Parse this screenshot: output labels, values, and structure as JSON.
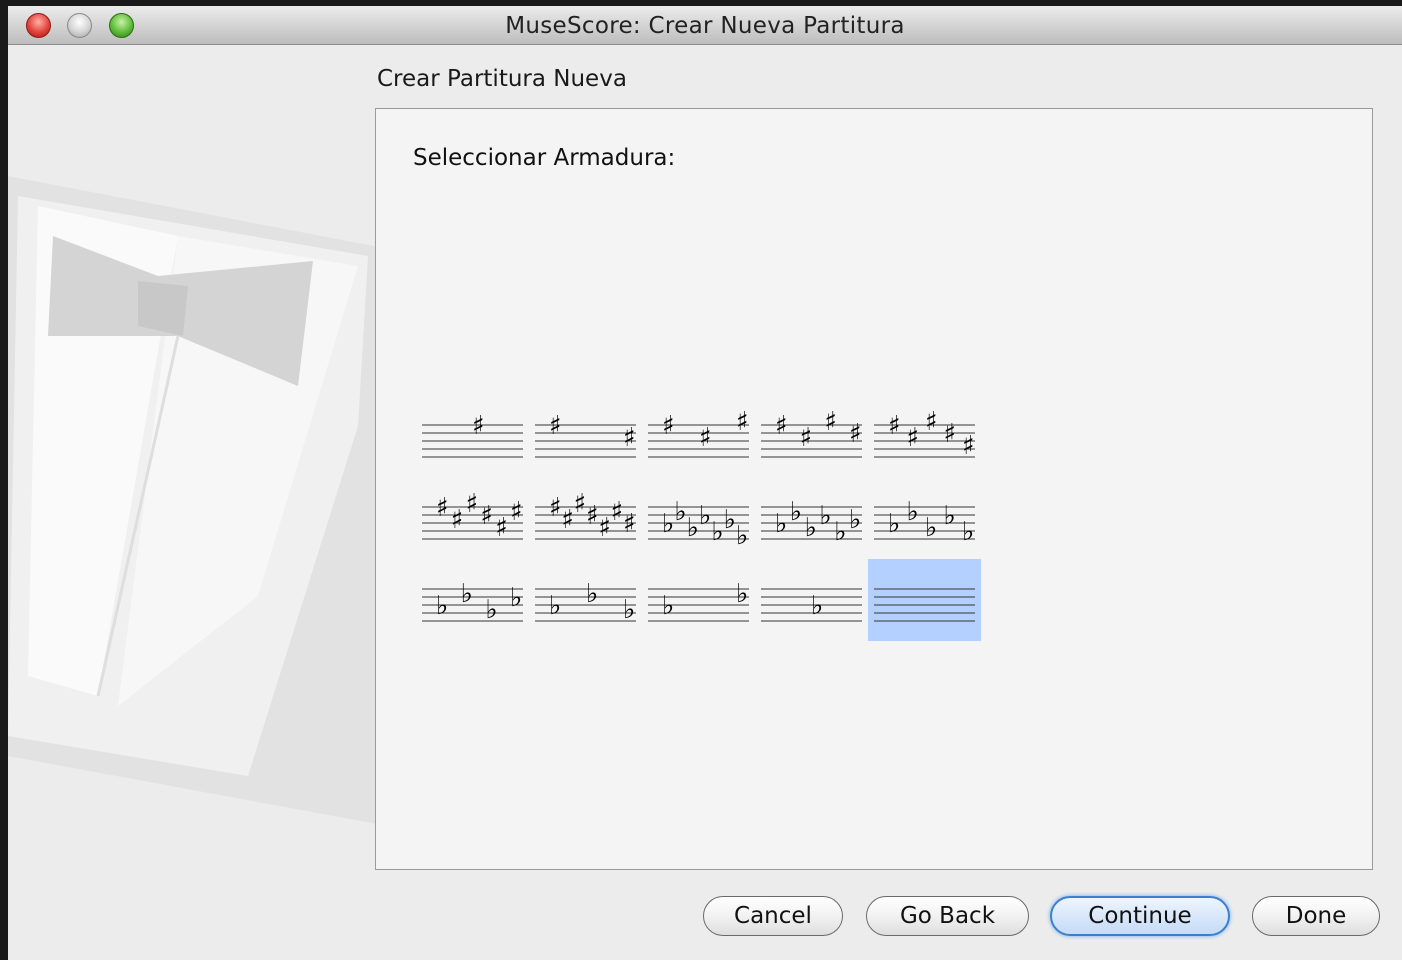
{
  "window": {
    "title": "MuseScore: Crear Nueva Partitura"
  },
  "wizard": {
    "heading": "Crear Partitura Nueva",
    "prompt": "Seleccionar Armadura:"
  },
  "key_signatures": [
    {
      "name": "1 sharp",
      "accidental": "sharp",
      "count": 1,
      "selected": false
    },
    {
      "name": "2 sharps",
      "accidental": "sharp",
      "count": 2,
      "selected": false
    },
    {
      "name": "3 sharps",
      "accidental": "sharp",
      "count": 3,
      "selected": false
    },
    {
      "name": "4 sharps",
      "accidental": "sharp",
      "count": 4,
      "selected": false
    },
    {
      "name": "5 sharps",
      "accidental": "sharp",
      "count": 5,
      "selected": false
    },
    {
      "name": "6 sharps",
      "accidental": "sharp",
      "count": 6,
      "selected": false
    },
    {
      "name": "7 sharps",
      "accidental": "sharp",
      "count": 7,
      "selected": false
    },
    {
      "name": "7 flats",
      "accidental": "flat",
      "count": 7,
      "selected": false
    },
    {
      "name": "6 flats",
      "accidental": "flat",
      "count": 6,
      "selected": false
    },
    {
      "name": "5 flats",
      "accidental": "flat",
      "count": 5,
      "selected": false
    },
    {
      "name": "4 flats",
      "accidental": "flat",
      "count": 4,
      "selected": false
    },
    {
      "name": "3 flats",
      "accidental": "flat",
      "count": 3,
      "selected": false
    },
    {
      "name": "2 flats",
      "accidental": "flat",
      "count": 2,
      "selected": false
    },
    {
      "name": "1 flat",
      "accidental": "flat",
      "count": 1,
      "selected": false
    },
    {
      "name": "no accidentals",
      "accidental": "none",
      "count": 0,
      "selected": true
    }
  ],
  "buttons": {
    "cancel": "Cancel",
    "back": "Go Back",
    "continue": "Continue",
    "done": "Done"
  },
  "colors": {
    "selection": "#b3d0ff",
    "default_button": "#3a7fd0"
  }
}
